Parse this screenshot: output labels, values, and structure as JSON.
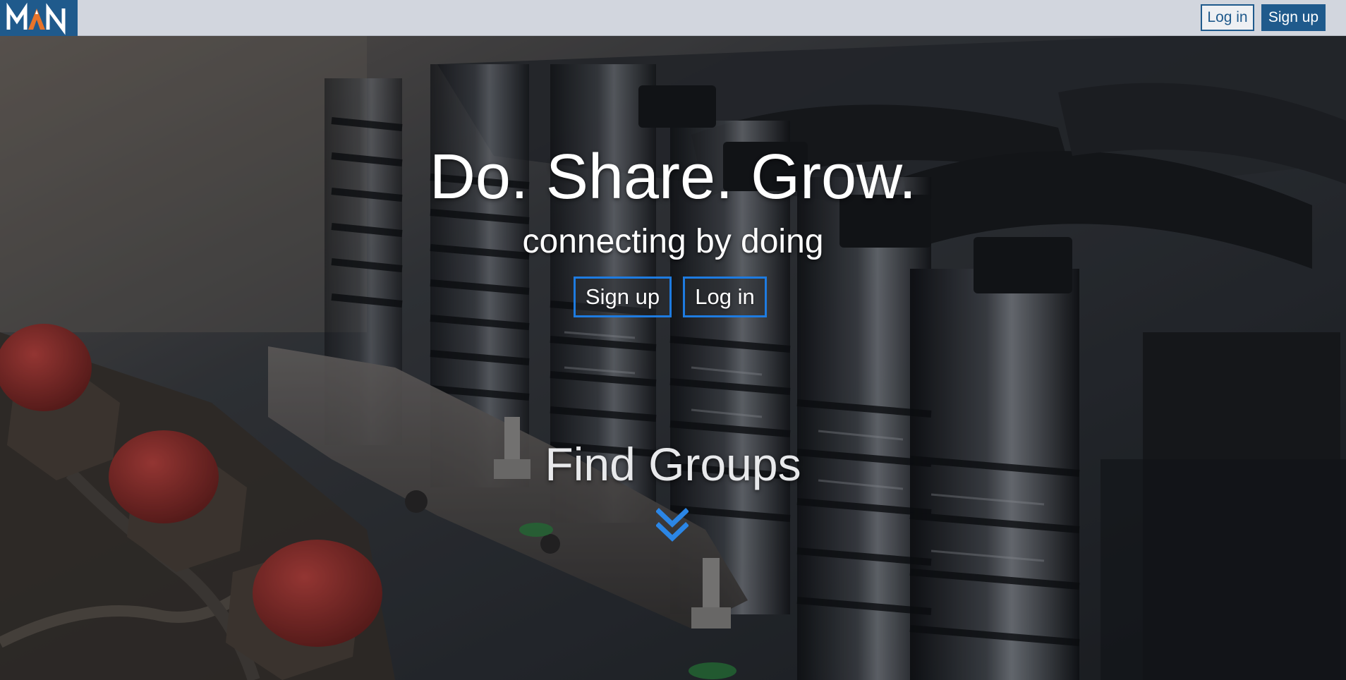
{
  "brand": {
    "logo_text": "MAN",
    "colors": {
      "navbar_bg": "#d2d6de",
      "brand_blue": "#1f5a8c",
      "cta_border": "#1e7be0",
      "chevron": "#2b86e6",
      "logo_accent": "#e8742a"
    }
  },
  "navbar": {
    "login_label": "Log in",
    "signup_label": "Sign up"
  },
  "hero": {
    "title": "Do. Share. Grow.",
    "subtitle": "connecting by doing",
    "signup_label": "Sign up",
    "login_label": "Log in",
    "section_label": "Find Groups",
    "scroll_icon": "chevron-double-down-icon",
    "background": "engine valve springs photo"
  }
}
